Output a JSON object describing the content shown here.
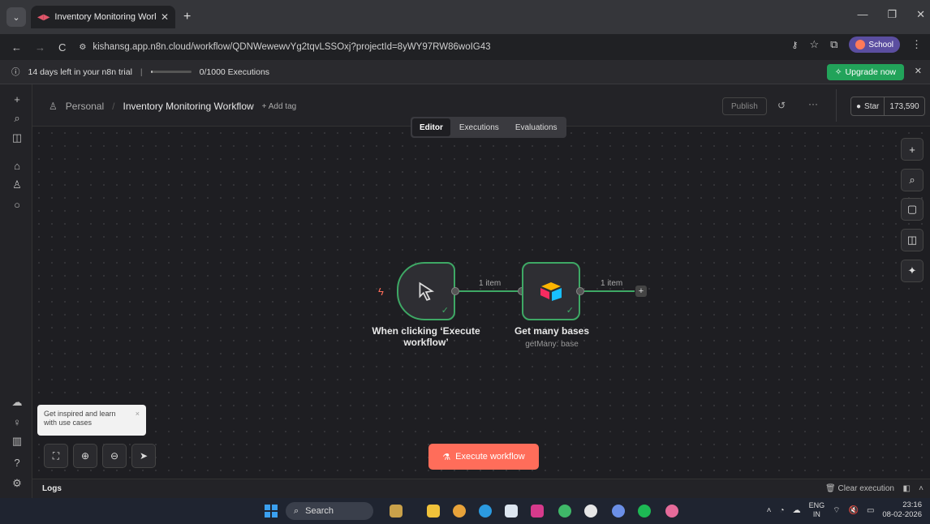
{
  "browser": {
    "tab_title": "Inventory Monitoring Workfl",
    "tab_menu_icon": "chevron-down-icon",
    "new_tab": "+",
    "url": "kishansg.app.n8n.cloud/workflow/QDNWewewvYg2tqvLSSOxj?projectId=8yWY97RW86woIG43",
    "profile_label": "School"
  },
  "trial": {
    "text": "14 days left in your n8n trial",
    "executions": "0/1000 Executions",
    "executions_used": 0,
    "upgrade_label": "Upgrade now"
  },
  "header": {
    "project": "Personal",
    "workflow_name": "Inventory Monitoring Workflow",
    "add_tag": "+ Add tag",
    "publish_label": "Publish",
    "more": "···",
    "star_label": "Star",
    "star_count": "173,590"
  },
  "mode_tabs": [
    "Editor",
    "Executions",
    "Evaluations"
  ],
  "canvas": {
    "nodes": [
      {
        "name_line1": "When clicking ‘Execute",
        "name_line2": "workflow’",
        "subtitle": ""
      },
      {
        "name_line1": "Get many bases",
        "name_line2": "",
        "subtitle": "getMany: base"
      }
    ],
    "connection_labels": [
      "1 item",
      "1 item"
    ],
    "execute_label": "Execute workflow"
  },
  "tooltip": {
    "line1": "Get inspired and learn",
    "line2": "with use cases",
    "close": "×"
  },
  "logs": {
    "label": "Logs",
    "clear_label": "Clear execution"
  },
  "taskbar": {
    "search_label": "Search",
    "lang_top": "ENG",
    "lang_bottom": "IN",
    "time": "23:16",
    "date": "08-02-2026"
  },
  "colors": {
    "accent": "#ff6d5a",
    "success": "#3ea865",
    "upgrade": "#22a35a",
    "canvas_bg": "#1e1e22"
  }
}
